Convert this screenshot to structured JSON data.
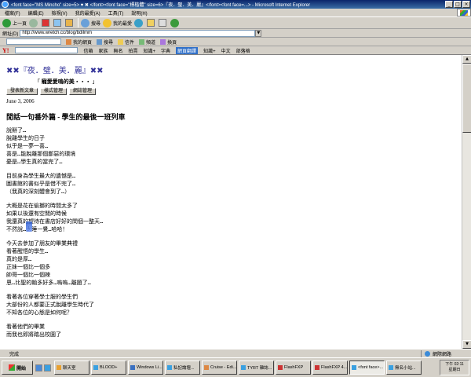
{
  "window": {
    "title": "<font face=\"MS Mincho\" size=5> ♥ ✖ </font><font face=\"標楷體\" size=6>『夜．璧．美．麗』</font><font face=...> - Microsoft Internet Explorer",
    "min": "_",
    "max": "□",
    "close": "×"
  },
  "menu": [
    "檔案(F)",
    "編輯(E)",
    "檢視(V)",
    "我的最愛(A)",
    "工具(T)",
    "說明(H)"
  ],
  "toolbar": {
    "back": "上一頁",
    "search": "搜尋",
    "favorites": "我的最愛"
  },
  "address": {
    "label": "網址(D)",
    "url": "http://www.wretch.cc/blog/bdilmm"
  },
  "links": [
    "我的網頁",
    "搜尋",
    "信件",
    "頻道",
    "換頁"
  ],
  "ybar": {
    "logo": "Y!",
    "items": [
      "信箱",
      "家族",
      "無名",
      "拍賣",
      "知識+",
      "字典",
      "網頁翻譯",
      "知識+",
      "中文",
      "部落格"
    ]
  },
  "blog": {
    "title": "✖✖『夜．璧．美．麗』✖✖",
    "subtitle": "寵愛愛嗚的美‧‧‧",
    "buttons": [
      "發表新文章",
      "樣式管理",
      "網誌管理"
    ],
    "date": "June 3, 2006",
    "post_title": "閒話一句番外篇 - 學生的最後一班列車",
    "paragraphs": [
      [
        "說掰了…",
        "脫離學生的日子",
        "似乎是一夢一喜…",
        "喜是…能脫離那個鄙惡的環境",
        "憂是…學生真的當完了…"
      ],
      [
        "目前身為學生最大的遺憾是…",
        "圖書館的書似乎是借不完了…",
        "（我真的深刻體會到了…）"
      ],
      [
        "大概是花在偷擲的時間太多了",
        "如果以後還有空閒的時候",
        "我還真的望待在書店好好的問個一整天…",
        "不然說…太睡一覺…哈哈！"
      ],
      [
        "今天去參加了朋友的畢業典禮",
        "看著醒悟的學生…",
        "真的是厚…",
        "正妹一個比一個多",
        "帥哥一個比一個辣",
        "恩…比聖的翰多好多…嗚嗚…離題了…"
      ],
      [
        "看著各位穿著學士服的學生們",
        "大部份的人都要正式脫離學生時代了",
        "不知各位的心態是如何呢？"
      ],
      [
        "看著他們的畢業",
        "而我也即將踏出校園了"
      ]
    ]
  },
  "status": {
    "text": "完成",
    "zone": "網際網路"
  },
  "taskbar": {
    "start": "開始",
    "tasks": [
      "聊天室",
      "BLOOD+",
      "Windows Li...",
      "私記論壇...",
      "Cruise - Edi...",
      "TYRT 雜誌...",
      "FlashFXP",
      "FlashFXP 4...",
      "<font face>...",
      "無名小站..."
    ],
    "time": "下午 02:11",
    "day": "星期日"
  },
  "colors": {
    "titlebar": "#0a246a",
    "chrome": "#d4d0c8",
    "blog_title": "#333399",
    "yahoo_red": "#cc0000"
  }
}
